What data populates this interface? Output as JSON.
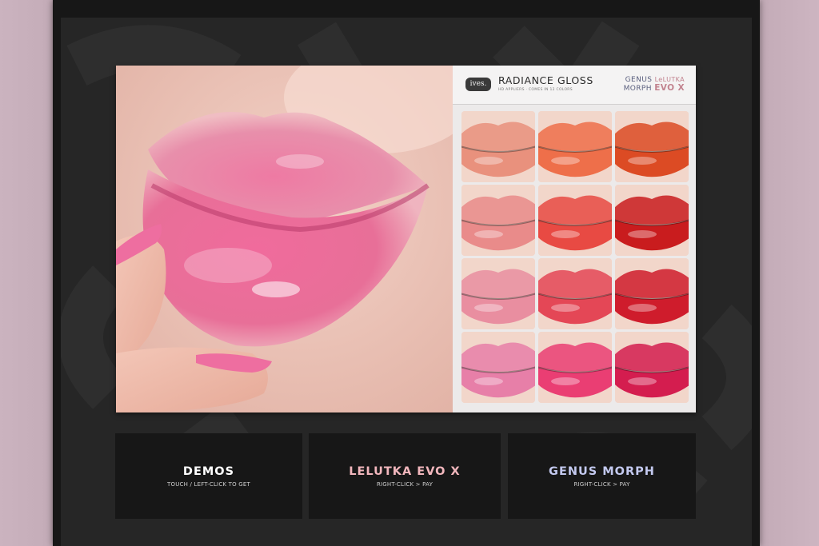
{
  "panel": {
    "brand": "ives.",
    "product_title": "RADIANCE GLOSS",
    "product_subtitle": "HD APPLIERS · COMES IN 12 COLORS",
    "compat_line1": "GENUS",
    "compat_lelutka": "LeLUTKA",
    "compat_line2": "MORPH",
    "compat_evo": "EVO X"
  },
  "swatch_colors": [
    "#e9917d",
    "#ee6f4a",
    "#dc4b24",
    "#e98b8a",
    "#e84a43",
    "#c91c1e",
    "#e98ea0",
    "#e44756",
    "#cf1c2c",
    "#e77fa8",
    "#ea3e73",
    "#d41d4f"
  ],
  "buttons": {
    "demos": {
      "title": "DEMOS",
      "subtitle": "TOUCH / LEFT-CLICK TO GET"
    },
    "lelutka": {
      "title": "LELUTKA EVO X",
      "subtitle": "RIGHT-CLICK > PAY"
    },
    "genus": {
      "title": "GENUS MORPH",
      "subtitle": "RIGHT-CLICK > PAY"
    }
  },
  "colors": {
    "lelutka_title": "#f2b7bd",
    "genus_title": "#c3c9ef",
    "demos_title": "#ffffff"
  }
}
